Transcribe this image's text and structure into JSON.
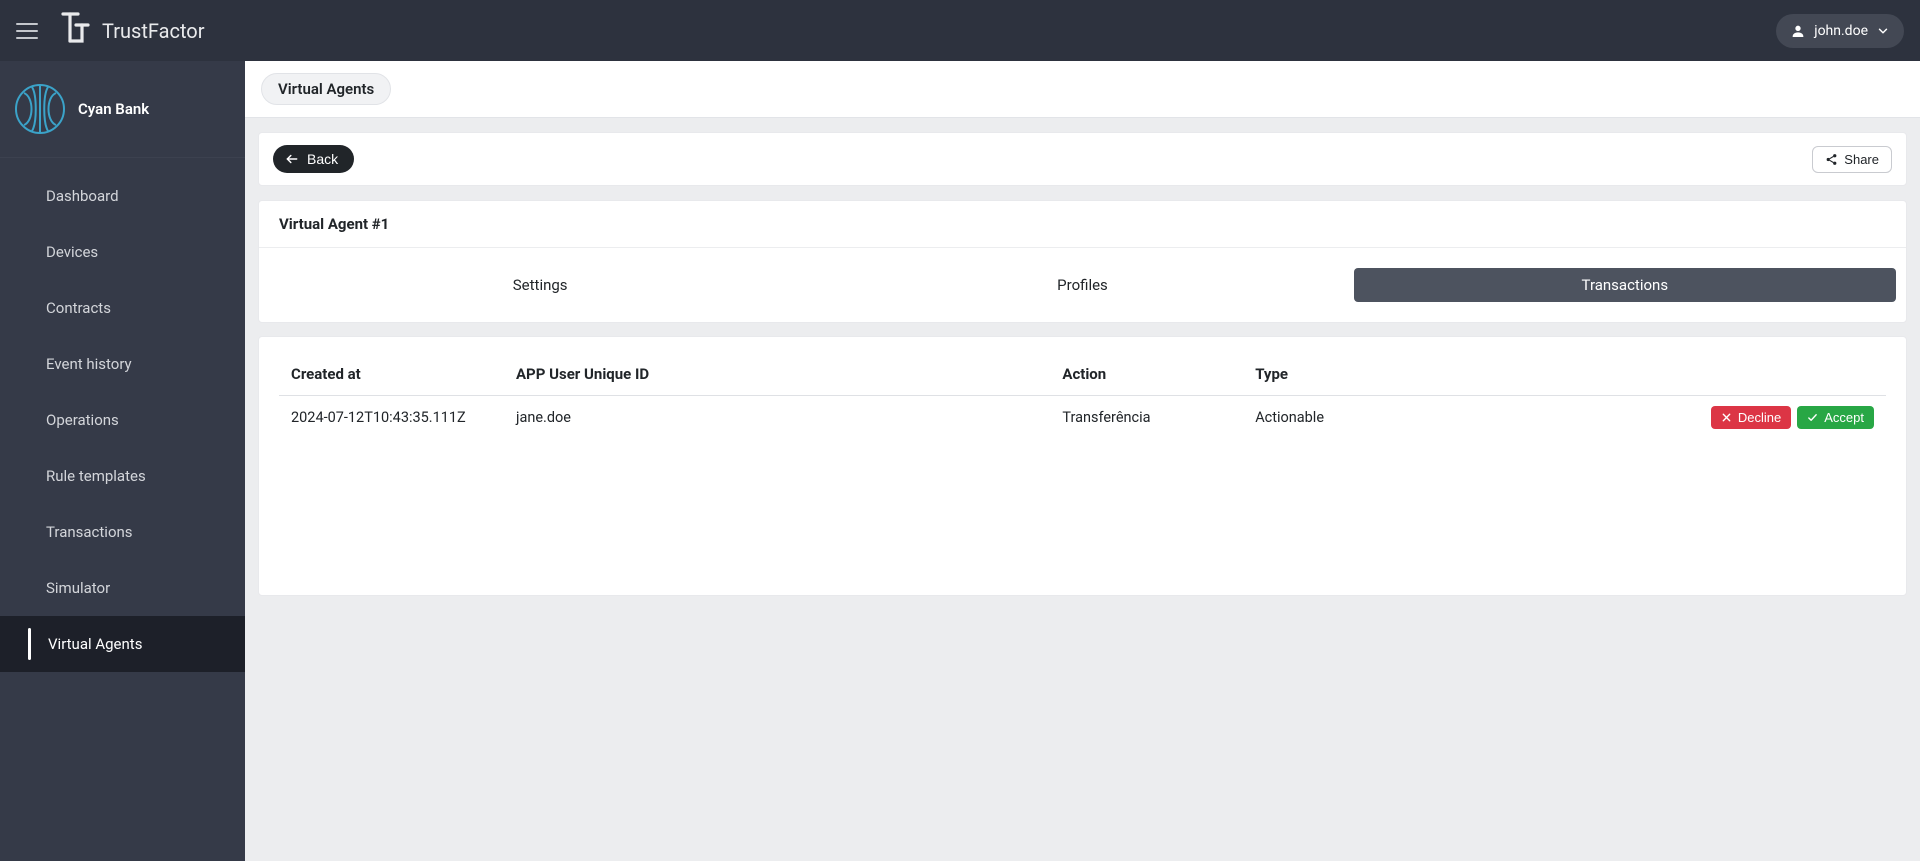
{
  "header": {
    "brand": "TrustFactor",
    "user": "john.doe"
  },
  "sidebar": {
    "org_name": "Cyan Bank",
    "items": [
      {
        "label": "Dashboard",
        "active": false
      },
      {
        "label": "Devices",
        "active": false
      },
      {
        "label": "Contracts",
        "active": false
      },
      {
        "label": "Event history",
        "active": false
      },
      {
        "label": "Operations",
        "active": false
      },
      {
        "label": "Rule templates",
        "active": false
      },
      {
        "label": "Transactions",
        "active": false
      },
      {
        "label": "Simulator",
        "active": false
      },
      {
        "label": "Virtual Agents",
        "active": true
      }
    ]
  },
  "breadcrumb": {
    "label": "Virtual Agents"
  },
  "actions": {
    "back": "Back",
    "share": "Share"
  },
  "agent": {
    "title": "Virtual Agent #1",
    "tabs": [
      {
        "label": "Settings",
        "active": false
      },
      {
        "label": "Profiles",
        "active": false
      },
      {
        "label": "Transactions",
        "active": true
      }
    ]
  },
  "table": {
    "headers": {
      "created_at": "Created at",
      "app_user": "APP User Unique ID",
      "action": "Action",
      "type": "Type"
    },
    "rows": [
      {
        "created_at": "2024-07-12T10:43:35.111Z",
        "app_user": "jane.doe",
        "action": "Transferência",
        "type": "Actionable"
      }
    ],
    "buttons": {
      "decline": "Decline",
      "accept": "Accept"
    }
  }
}
